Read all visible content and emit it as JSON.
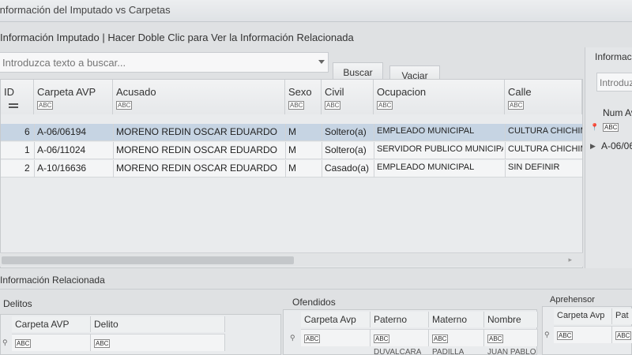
{
  "window": {
    "title": "Información del Imputado vs Carpetas"
  },
  "subtitle": "Información Imputado | Hacer Doble Clic para Ver la Información Relacionada",
  "search": {
    "placeholder": "Introduzca texto a buscar...",
    "buscar_label": "Buscar",
    "vaciar_label": "Vaciar"
  },
  "grid": {
    "columns": [
      "ID",
      "Carpeta AVP",
      "Acusado",
      "Sexo",
      "Civil",
      "Ocupacion",
      "Calle"
    ],
    "filter_glyph": "ABC",
    "rows": [
      {
        "id": "6",
        "carpeta": "A-06/06194",
        "acusado": "MORENO REDIN OSCAR EDUARDO",
        "sexo": "M",
        "civil": "Soltero(a)",
        "ocupacion": "EMPLEADO MUNICIPAL",
        "calle": "CULTURA CHICHIM"
      },
      {
        "id": "1",
        "carpeta": "A-06/11024",
        "acusado": "MORENO  REDIN OSCAR EDUARDO",
        "sexo": "M",
        "civil": "Soltero(a)",
        "ocupacion": "SERVIDOR PUBLICO MUNICIPA",
        "calle": "CULTURA CHICHIM"
      },
      {
        "id": "2",
        "carpeta": "A-10/16636",
        "acusado": "MORENO REDIN OSCAR EDUARDO",
        "sexo": "M",
        "civil": "Casado(a)",
        "ocupacion": "EMPLEADO MUNICIPAL",
        "calle": "SIN DEFINIR"
      }
    ]
  },
  "right_panel": {
    "title": "Informacio",
    "search_placeholder": "Introduz",
    "column": "Num Av",
    "row_value": "A-06/06"
  },
  "related": {
    "title": "Información Relacionada",
    "delitos": {
      "title": "Delitos",
      "columns": [
        "Carpeta AVP",
        "Delito"
      ]
    },
    "ofendidos": {
      "title": "Ofendidos",
      "columns": [
        "Carpeta Avp",
        "Paterno",
        "Materno",
        "Nombre"
      ],
      "partial_row": [
        "",
        "DUVALCARA",
        "PADILLA",
        "JUAN PABLO"
      ]
    },
    "aprehensor": {
      "title": "Aprehensor",
      "columns": [
        "Carpeta Avp",
        "Pat"
      ]
    }
  }
}
